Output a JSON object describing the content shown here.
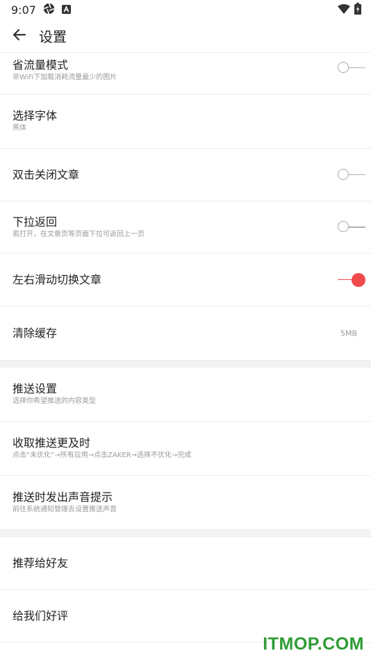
{
  "status_bar": {
    "time": "9:07",
    "icons": [
      "aperture-icon",
      "a-badge-icon",
      "wifi-icon",
      "battery-charging-icon"
    ]
  },
  "app_bar": {
    "back_icon": "arrow-left-icon",
    "title": "设置"
  },
  "settings": {
    "data_saver": {
      "title": "省流量模式",
      "subtitle": "非WiFi下加载消耗流量最少的图片",
      "switch_on": false
    },
    "font": {
      "title": "选择字体",
      "subtitle": "黑体"
    },
    "double_tap_close": {
      "title": "双击关闭文章",
      "switch_on": false
    },
    "pull_back": {
      "title": "下拉返回",
      "subtitle": "若打开，在文章页等页面下拉可返回上一页",
      "switch_on": false
    },
    "swipe_switch": {
      "title": "左右滑动切换文章",
      "switch_on": true
    },
    "clear_cache": {
      "title": "清除缓存",
      "value": "5MB"
    },
    "push_settings": {
      "title": "推送设置",
      "subtitle": "选择你希望推送的内容类型"
    },
    "push_timely": {
      "title": "收取推送更及时",
      "subtitle": "点击“未优化”→所有应用→点击ZAKER→选择不优化→完成"
    },
    "push_sound": {
      "title": "推送时发出声音提示",
      "subtitle": "前往系统通知管理去设置推送声音"
    },
    "recommend": {
      "title": "推荐给好友"
    },
    "rate": {
      "title": "给我们好评"
    }
  },
  "colors": {
    "accent": "#f24a4a",
    "watermark": "#2e9b35"
  },
  "watermark": "ITMOP.COM"
}
